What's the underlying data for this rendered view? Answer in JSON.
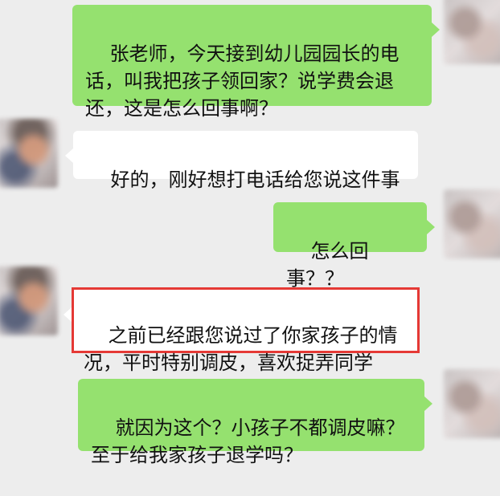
{
  "messages": [
    {
      "side": "right",
      "text": "张老师，今天接到幼儿园园长的电话，叫我把孩子领回家？说学费会退还，这是怎么回事啊？"
    },
    {
      "side": "left",
      "text": "好的，刚好想打电话给您说这件事"
    },
    {
      "side": "right",
      "text": "怎么回事？？"
    },
    {
      "side": "left",
      "text": "之前已经跟您说过了你家孩子的情况，平时特别调皮，喜欢捉弄同学",
      "highlighted": true
    },
    {
      "side": "right",
      "text": "就因为这个？小孩子不都调皮嘛？至于给我家孩子退学吗？"
    }
  ],
  "colors": {
    "background": "#ededed",
    "sent_bubble": "#95e16f",
    "received_bubble": "#ffffff",
    "highlight_border": "#e53935"
  },
  "icons": {
    "sender_avatar": "avatar",
    "receiver_avatar": "avatar"
  }
}
